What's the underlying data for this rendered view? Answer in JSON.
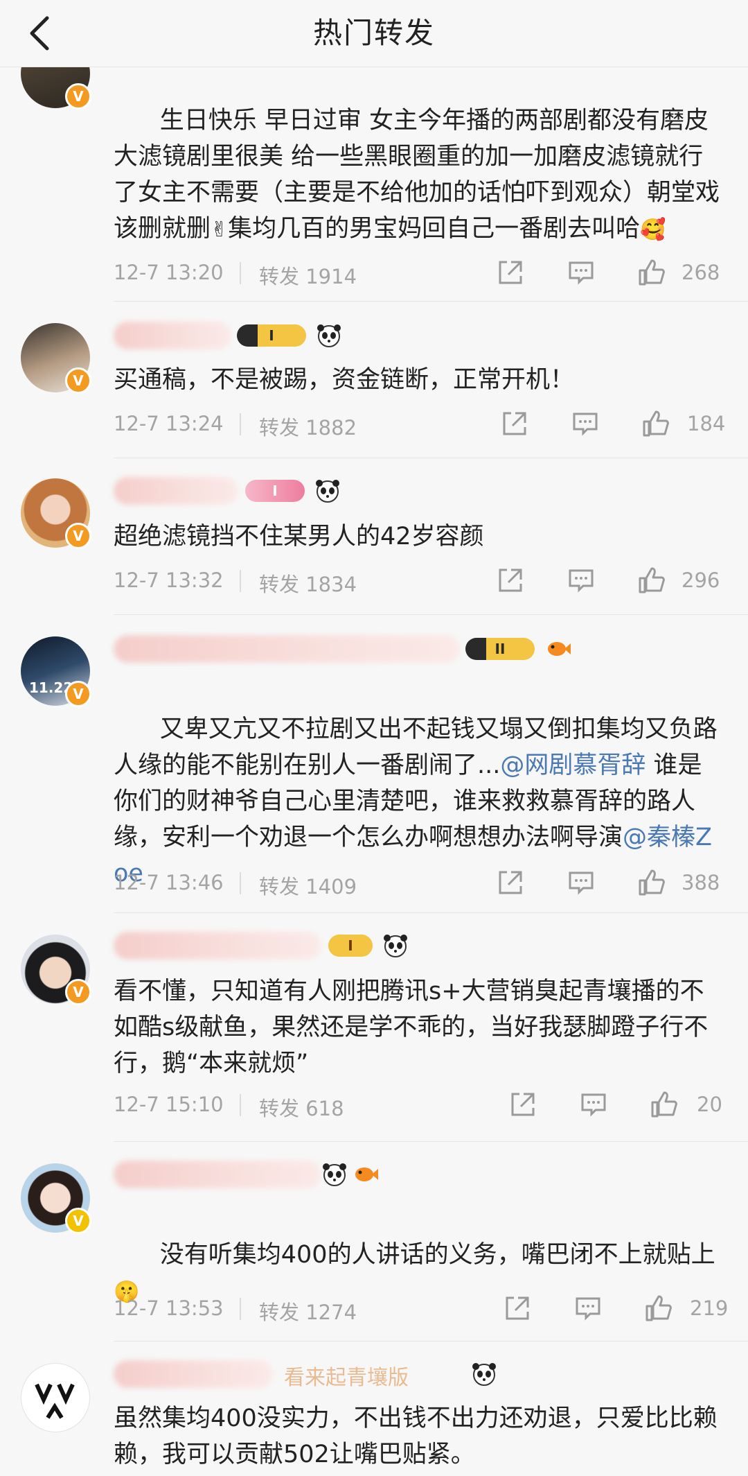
{
  "nav": {
    "title": "热门转发"
  },
  "comments": [
    {
      "text": "生日快乐 早日过审 女主今年播的两部剧都没有磨皮大滤镜剧里很美 给一些黑眼圈重的加一加磨皮滤镜就行了女主不需要（主要是不给他加的话怕吓到观众）朝堂戏该删就删",
      "emoji1": "✌",
      "text2": "集均几百的男宝妈回自己一番剧去叫哈",
      "emoji2": "🥰",
      "time": "12-7 13:20",
      "repost": "转发 1914",
      "likes": "268"
    },
    {
      "text": "买通稿，不是被踢，资金链断，正常开机！",
      "time": "12-7 13:24",
      "repost": "转发 1882",
      "likes": "184",
      "level": "I"
    },
    {
      "text": "超绝滤镜挡不住某男人的42岁容颜",
      "time": "12-7 13:32",
      "repost": "转发 1834",
      "likes": "296",
      "level": "I"
    },
    {
      "text_a": "又卑又亢又不拉剧又出不起钱又塌又倒扣集均又负路人缘的能不能别在别人一番剧闹了...",
      "mention1": "@网剧慕胥辞",
      "text_b": " 谁是你们的财神爷自己心里清楚吧，谁来救救慕胥辞的路人缘，安利一个劝退一个怎么办啊想想办法啊导演",
      "mention2": "@秦榛Zoe",
      "time": "12-7 13:46",
      "repost": "转发 1409",
      "likes": "388",
      "level": "II",
      "avatar_caption": "11.22"
    },
    {
      "text": "看不懂，只知道有人刚把腾讯s+大营销臭起青壤播的不如酷s级献鱼，果然还是学不乖的，当好我瑟脚蹬子行不行，鹅“本来就烦”",
      "time": "12-7 15:10",
      "repost": "转发 618",
      "likes": "20",
      "level": "I"
    },
    {
      "text": "没有听集均400的人讲话的义务，嘴巴闭不上就贴上",
      "emoji": "🤫",
      "time": "12-7 13:53",
      "repost": "转发 1274",
      "likes": "219"
    },
    {
      "text": "虽然集均400没实力，不出钱不出力还劝退，只爱比比赖赖，我可以贡献502让嘴巴贴紧。",
      "name_tail": "看来起青壤版"
    }
  ],
  "icons": {
    "back": "chevron-left-icon",
    "share": "share-icon",
    "comment": "comment-icon",
    "like": "thumbs-up-icon"
  },
  "colors": {
    "accent": "#f59a20",
    "mention": "#4a79b3",
    "meta": "#a4a4a4"
  }
}
